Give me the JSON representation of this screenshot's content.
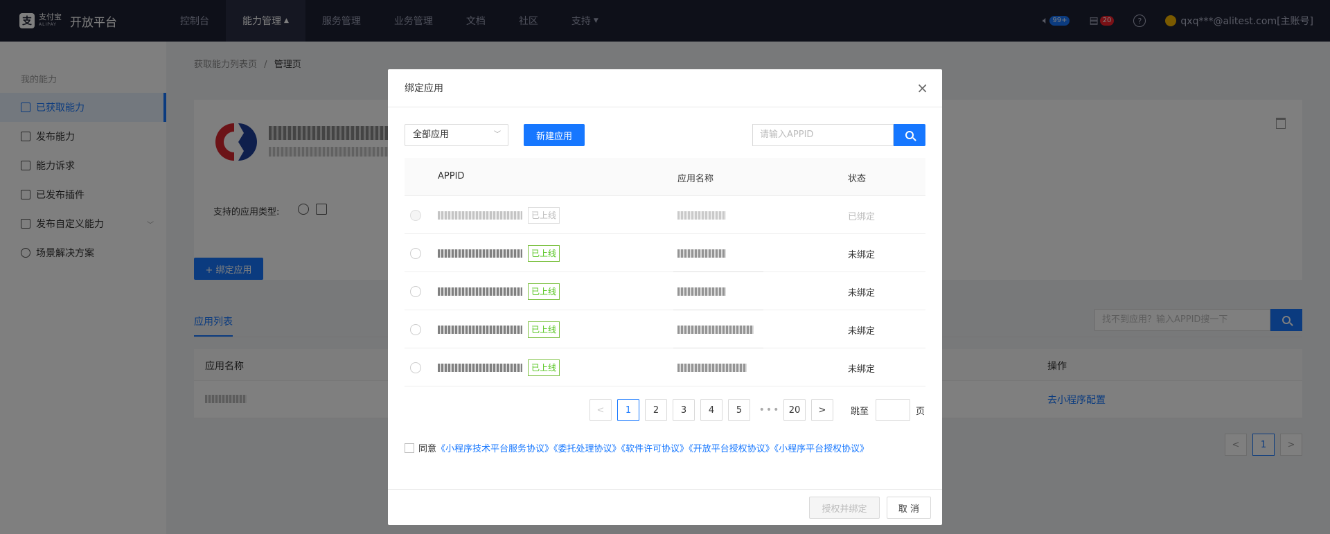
{
  "topbar": {
    "logo_cn": "支付宝",
    "logo_en": "ALIPAY",
    "platform": "开放平台",
    "nav": [
      {
        "label": "控制台"
      },
      {
        "label": "能力管理"
      },
      {
        "label": "服务管理"
      },
      {
        "label": "业务管理"
      },
      {
        "label": "文档"
      },
      {
        "label": "社区"
      },
      {
        "label": "支持"
      }
    ],
    "sound_badge": "99+",
    "msg_badge": "20",
    "help": "?",
    "account": "qxq***@alitest.com[主账号]"
  },
  "sidebar": {
    "group": "我的能力",
    "items": [
      {
        "label": "已获取能力"
      },
      {
        "label": "发布能力"
      },
      {
        "label": "能力诉求"
      },
      {
        "label": "已发布插件"
      },
      {
        "label": "发布自定义能力"
      },
      {
        "label": "场景解决方案"
      }
    ]
  },
  "main": {
    "breadcrumb_1": "获取能力列表页",
    "breadcrumb_sep": "/",
    "breadcrumb_2": "管理页",
    "types_label": "支持的应用类型:",
    "bind_button": "+ 绑定应用",
    "tab": "应用列表",
    "search_placeholder": "找不到应用？输入APPID搜一下",
    "col_name": "应用名称",
    "col_action": "操作",
    "row_action": "去小程序配置",
    "page": "1"
  },
  "modal": {
    "title": "绑定应用",
    "close": "×",
    "select_value": "全部应用",
    "new_button": "新建应用",
    "search_placeholder": "请输入APPID",
    "columns": {
      "appid": "APPID",
      "name": "应用名称",
      "status": "状态"
    },
    "rows": [
      {
        "tag": "已上线",
        "status": "已绑定",
        "disabled": true
      },
      {
        "tag": "已上线",
        "status": "未绑定",
        "disabled": false
      },
      {
        "tag": "已上线",
        "status": "未绑定",
        "disabled": false
      },
      {
        "tag": "已上线",
        "status": "未绑定",
        "disabled": false
      },
      {
        "tag": "已上线",
        "status": "未绑定",
        "disabled": false
      }
    ],
    "pager": {
      "prev": "<",
      "pages": [
        "1",
        "2",
        "3",
        "4",
        "5"
      ],
      "ellipsis": "•••",
      "last": "20",
      "next": ">",
      "current": "1",
      "jump_label": "跳至",
      "jump_unit": "页"
    },
    "agree": {
      "prefix": "同意",
      "links": [
        "《小程序技术平台服务协议》",
        "《委托处理协议》",
        "《软件许可协议》",
        "《开放平台授权协议》",
        "《小程序平台授权协议》"
      ]
    },
    "auth_button": "授权并绑定",
    "cancel_button": "取 消"
  },
  "colors": {
    "nav_bg": "#1d2033",
    "primary": "#1677ff",
    "online_tag": "#52c41a",
    "overlay": "rgba(0,0,0,0.5)"
  }
}
